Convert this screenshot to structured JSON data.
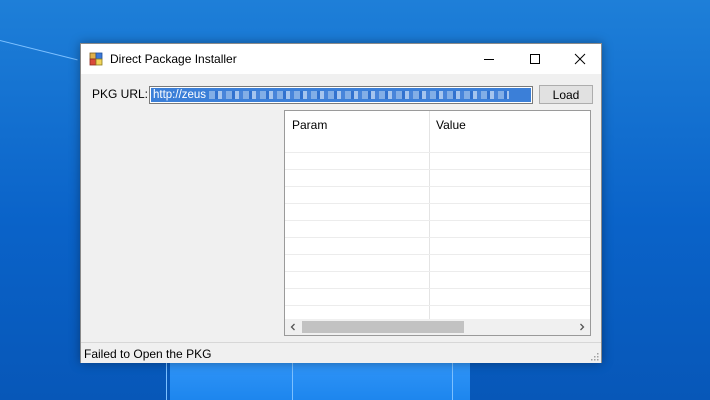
{
  "window": {
    "title": "Direct Package Installer",
    "controls": {
      "minimize": "minimize-icon",
      "maximize": "maximize-icon",
      "close": "close-icon"
    }
  },
  "form": {
    "url_label": "PKG URL:",
    "url_value_visible": "http://zeus",
    "load_label": "Load"
  },
  "table": {
    "columns": [
      "Param",
      "Value"
    ],
    "rows": []
  },
  "status": {
    "text": "Failed to Open the PKG"
  },
  "colors": {
    "desktop": "#0a63c9",
    "selection": "#3b7fd8",
    "window_bg": "#f0f0f0"
  }
}
